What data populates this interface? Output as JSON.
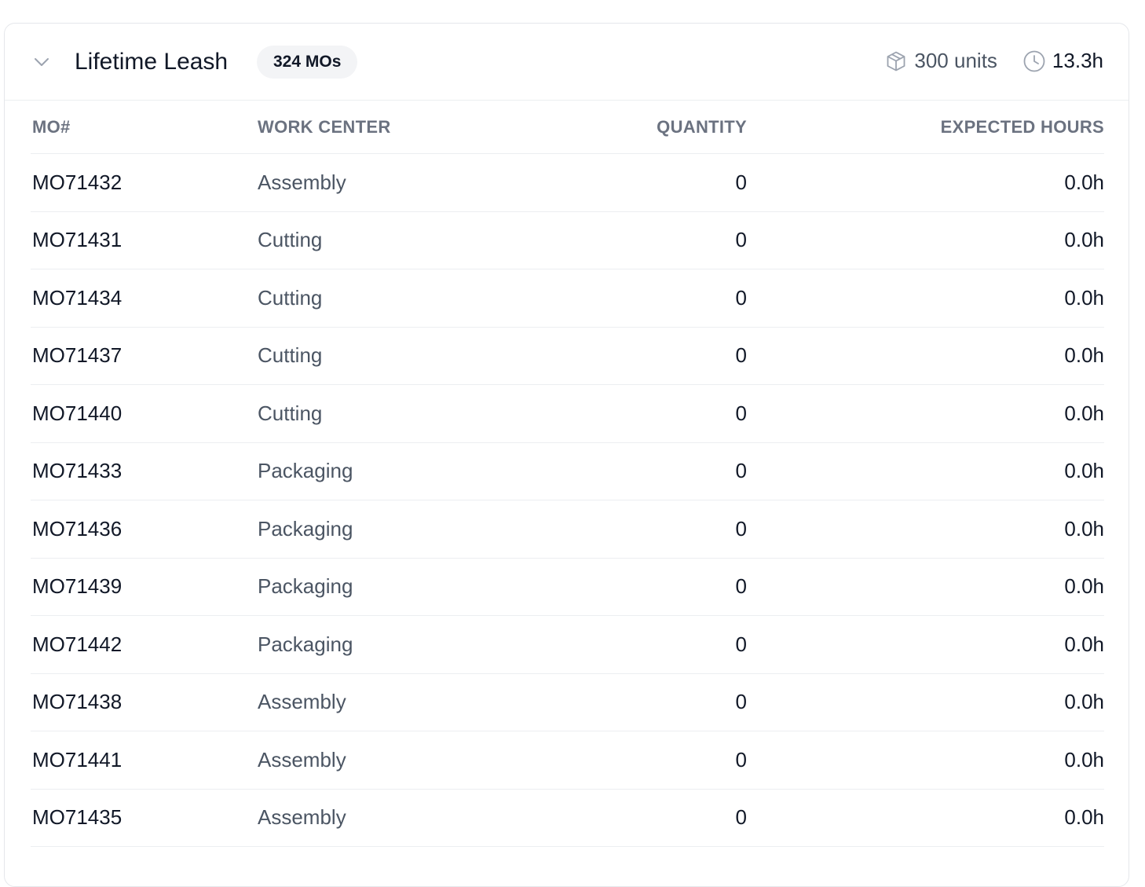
{
  "group": {
    "title": "Lifetime Leash",
    "badge": "324 MOs",
    "units": "300 units",
    "hours": "13.3h",
    "icons": {
      "collapse": "chevron-down-icon",
      "units": "package-icon",
      "hours": "clock-icon"
    }
  },
  "table": {
    "columns": [
      "MO#",
      "WORK CENTER",
      "QUANTITY",
      "EXPECTED HOURS"
    ],
    "rows": [
      {
        "mo": "MO71432",
        "work_center": "Assembly",
        "quantity": "0",
        "hours": "0.0h"
      },
      {
        "mo": "MO71431",
        "work_center": "Cutting",
        "quantity": "0",
        "hours": "0.0h"
      },
      {
        "mo": "MO71434",
        "work_center": "Cutting",
        "quantity": "0",
        "hours": "0.0h"
      },
      {
        "mo": "MO71437",
        "work_center": "Cutting",
        "quantity": "0",
        "hours": "0.0h"
      },
      {
        "mo": "MO71440",
        "work_center": "Cutting",
        "quantity": "0",
        "hours": "0.0h"
      },
      {
        "mo": "MO71433",
        "work_center": "Packaging",
        "quantity": "0",
        "hours": "0.0h"
      },
      {
        "mo": "MO71436",
        "work_center": "Packaging",
        "quantity": "0",
        "hours": "0.0h"
      },
      {
        "mo": "MO71439",
        "work_center": "Packaging",
        "quantity": "0",
        "hours": "0.0h"
      },
      {
        "mo": "MO71442",
        "work_center": "Packaging",
        "quantity": "0",
        "hours": "0.0h"
      },
      {
        "mo": "MO71438",
        "work_center": "Assembly",
        "quantity": "0",
        "hours": "0.0h"
      },
      {
        "mo": "MO71441",
        "work_center": "Assembly",
        "quantity": "0",
        "hours": "0.0h"
      },
      {
        "mo": "MO71435",
        "work_center": "Assembly",
        "quantity": "0",
        "hours": "0.0h"
      }
    ]
  }
}
